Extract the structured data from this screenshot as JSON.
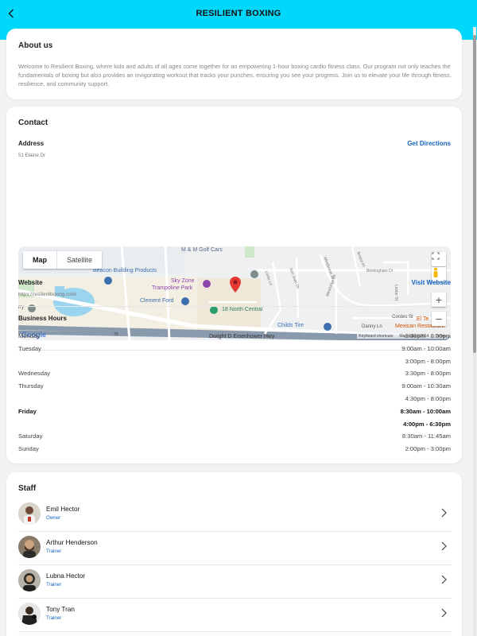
{
  "header": {
    "title": "RESILIENT BOXING"
  },
  "about": {
    "title": "About us",
    "text": "Welcome to Resilient Boxing, where kids and adults of all ages come together for an empowering 1-hour boxing cardio fitness class. Our program not only teaches the fundamentals of boxing but also provides an invigorating workout that tracks your punches, ensuring you see your progress. Join us to elevate your life through fitness, resilience, and community support."
  },
  "contact": {
    "title": "Contact",
    "address_label": "Address",
    "address_value": "51 Elaine Dr",
    "directions_link": "Get Directions",
    "website_label": "Website",
    "website_value": "https://resilientboxing.com/",
    "website_link": "Visit Website",
    "hours_label": "Business Hours",
    "hours": [
      {
        "day": "Monday",
        "time": "3:30pm - 8:00pm",
        "bold": false
      },
      {
        "day": "Tuesday",
        "time": "9:00am - 10:00am",
        "bold": false
      },
      {
        "day": "",
        "time": "3:00pm - 8:00pm",
        "bold": false
      },
      {
        "day": "Wednesday",
        "time": "3:30pm - 8:00pm",
        "bold": false
      },
      {
        "day": "Thursday",
        "time": "9:00am - 10:30am",
        "bold": false
      },
      {
        "day": "",
        "time": "4:30pm - 8:00pm",
        "bold": false
      },
      {
        "day": "Friday",
        "time": "8:30am - 10:00am",
        "bold": true
      },
      {
        "day": "",
        "time": "4:00pm - 6:30pm",
        "bold": true
      },
      {
        "day": "Saturday",
        "time": "8:30am - 11:45am",
        "bold": false
      },
      {
        "day": "Sunday",
        "time": "2:00pm - 3:00pm",
        "bold": false
      }
    ]
  },
  "map": {
    "map_tab": "Map",
    "satellite_tab": "Satellite",
    "zoom_in": "+",
    "zoom_out": "−",
    "google": "Google",
    "attribution": [
      "Keyboard shortcuts",
      "Map data ©2024",
      "Terms"
    ],
    "places": {
      "mm_golf": "M & M Golf Cars",
      "beacon": "Beacon Building Products",
      "sky_zone_1": "Sky Zone",
      "sky_zone_2": "Trampoline Park",
      "clement": "Clement Ford",
      "north_central": "18 North Central",
      "childs": "Childs Tire",
      "cordes": "Cordes St",
      "danny": "Danny Ln",
      "el_te": "El Te",
      "mexican": "Mexican Restaurant",
      "dwight": "Dwight D Eisenhower Hwy",
      "rry": "rry",
      "linda": "Linda Ln",
      "san_juan": "San Juan Dr",
      "westbrook": "Westbrook Dr",
      "westridge": "Westridge Dr",
      "bristol": "Bristol Pl",
      "birmingham": "Birmingham Dr",
      "lester": "Lester St",
      "highway_70": "70"
    }
  },
  "staff": {
    "title": "Staff",
    "members": [
      {
        "name": "Emil Hector",
        "role": "Owner"
      },
      {
        "name": "Arthur Henderson",
        "role": "Trainer"
      },
      {
        "name": "Lubna Hector",
        "role": "Trainer"
      },
      {
        "name": "Tony Tran",
        "role": "Trainer"
      }
    ]
  },
  "colors": {
    "header": "#00d8fb",
    "link": "#1565c0",
    "pin": "#e53935"
  }
}
